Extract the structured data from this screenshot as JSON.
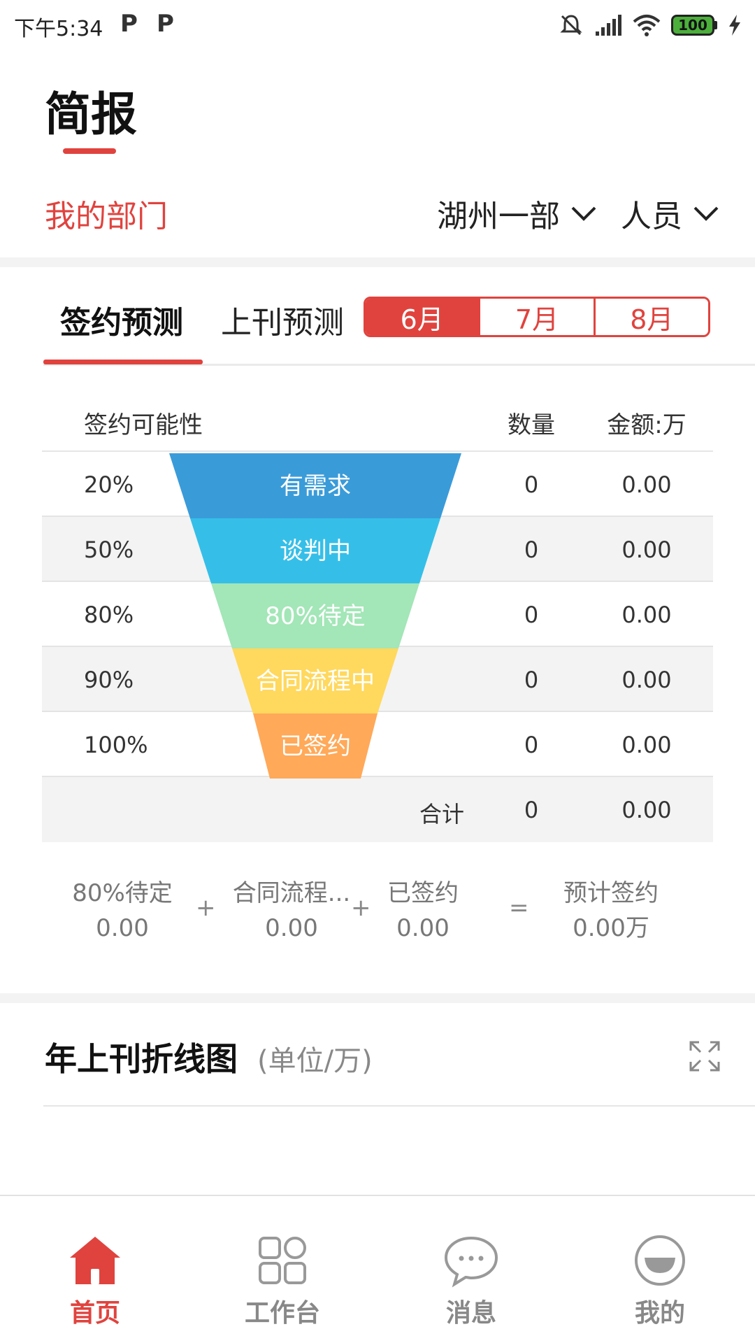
{
  "status_bar": {
    "time": "下午5:34",
    "app_icons": [
      "P",
      "P"
    ],
    "battery": "100"
  },
  "header": {
    "title": "简报"
  },
  "department": {
    "label": "我的部门",
    "filter_dept": "湖州一部",
    "filter_person": "人员"
  },
  "tabs": [
    {
      "label": "签约预测",
      "active": true
    },
    {
      "label": "上刊预测",
      "active": false
    }
  ],
  "months": [
    {
      "label": "6月",
      "active": true
    },
    {
      "label": "7月",
      "active": false
    },
    {
      "label": "8月",
      "active": false
    }
  ],
  "table": {
    "headers": {
      "probability": "签约可能性",
      "quantity": "数量",
      "amount": "金额:万"
    },
    "rows": [
      {
        "pct": "20%",
        "stage": "有需求",
        "qty": "0",
        "amount": "0.00",
        "color": "#3a9bd9"
      },
      {
        "pct": "50%",
        "stage": "谈判中",
        "qty": "0",
        "amount": "0.00",
        "color": "#35bfe8"
      },
      {
        "pct": "80%",
        "stage": "80%待定",
        "qty": "0",
        "amount": "0.00",
        "color": "#a3e6b7"
      },
      {
        "pct": "90%",
        "stage": "合同流程中",
        "qty": "0",
        "amount": "0.00",
        "color": "#ffd85e"
      },
      {
        "pct": "100%",
        "stage": "已签约",
        "qty": "0",
        "amount": "0.00",
        "color": "#ffa959"
      }
    ],
    "total": {
      "label": "合计",
      "qty": "0",
      "amount": "0.00"
    }
  },
  "formula": {
    "a": {
      "label": "80%待定",
      "value": "0.00"
    },
    "b": {
      "label": "合同流程...",
      "value": "0.00"
    },
    "c": {
      "label": "已签约",
      "value": "0.00"
    },
    "result": {
      "label": "预计签约",
      "value": "0.00万"
    },
    "plus": "+",
    "equals": "="
  },
  "chart_section": {
    "title": "年上刊折线图",
    "unit": "(单位/万)"
  },
  "bottom_nav": [
    {
      "label": "首页",
      "icon": "home-icon",
      "active": true
    },
    {
      "label": "工作台",
      "icon": "grid-icon",
      "active": false
    },
    {
      "label": "消息",
      "icon": "chat-icon",
      "active": false
    },
    {
      "label": "我的",
      "icon": "profile-icon",
      "active": false
    }
  ],
  "colors": {
    "accent": "#e0433e"
  }
}
